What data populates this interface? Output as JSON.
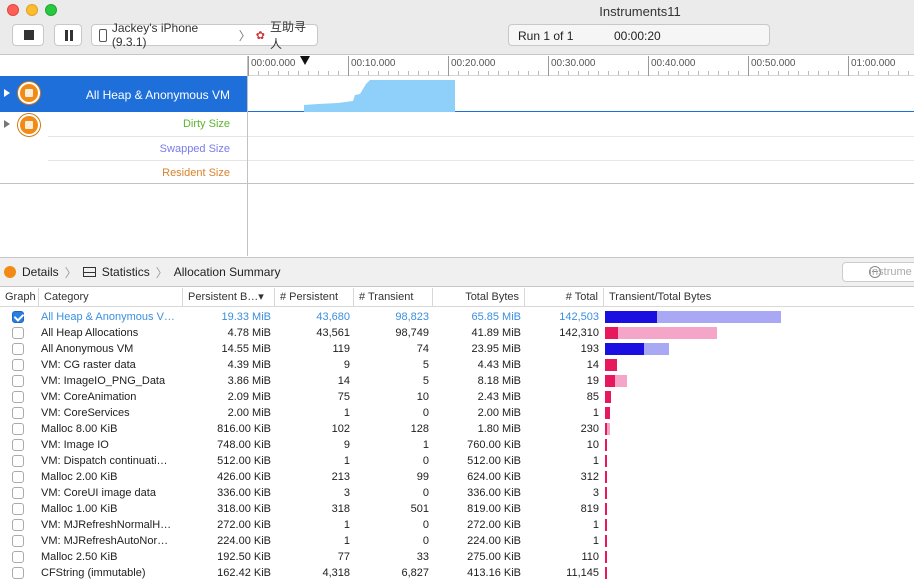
{
  "window": {
    "title": "Instruments11"
  },
  "toolbar": {
    "target_device": "Jackey's iPhone (9.3.1)",
    "target_app": "互助寻人",
    "run_label": "Run 1 of 1",
    "run_time": "00:00:20"
  },
  "timeline": {
    "ticks": [
      "00:00.000",
      "00:10.000",
      "00:20.000",
      "00:30.000",
      "00:40.000",
      "00:50.000",
      "01:00.000"
    ],
    "tracks": {
      "main": "All Heap & Anonymous VM",
      "sub": [
        "Dirty Size",
        "Swapped Size",
        "Resident Size"
      ]
    }
  },
  "colors": {
    "selection": "#1e6fd9",
    "graph_fill": "#8fd0fa",
    "persistent_blue": "#1a0fe0",
    "persistent_pink": "#e8185c",
    "transient_blue": "#a9a8f5",
    "transient_pink": "#f5a6c8",
    "dirty": "#5ab52c",
    "swapped": "#7b7be8",
    "resident": "#d9822b"
  },
  "jumpbar": {
    "crumbs": [
      "Details",
      "Statistics",
      "Allocation Summary"
    ],
    "filter_placeholder": "Instrume"
  },
  "table": {
    "columns": [
      "Graph",
      "Category",
      "Persistent B…▾",
      "# Persistent",
      "# Transient",
      "Total Bytes",
      "# Total",
      "Transient/Total Bytes"
    ],
    "rows": [
      {
        "checked": true,
        "category": "All Heap & Anonymous V…",
        "persistent_bytes": "19.33 MiB",
        "persistent": "43,680",
        "transient": "98,823",
        "total_bytes": "65.85 MiB",
        "total": "142,503",
        "bar_persistent": 19.33,
        "bar_total": 65.85,
        "bar_color": "blue"
      },
      {
        "checked": false,
        "category": "All Heap Allocations",
        "persistent_bytes": "4.78 MiB",
        "persistent": "43,561",
        "transient": "98,749",
        "total_bytes": "41.89 MiB",
        "total": "142,310",
        "bar_persistent": 4.78,
        "bar_total": 41.89,
        "bar_color": "pink"
      },
      {
        "checked": false,
        "category": "All Anonymous VM",
        "persistent_bytes": "14.55 MiB",
        "persistent": "119",
        "transient": "74",
        "total_bytes": "23.95 MiB",
        "total": "193",
        "bar_persistent": 14.55,
        "bar_total": 23.95,
        "bar_color": "blue"
      },
      {
        "checked": false,
        "category": "VM: CG raster data",
        "persistent_bytes": "4.39 MiB",
        "persistent": "9",
        "transient": "5",
        "total_bytes": "4.43 MiB",
        "total": "14",
        "bar_persistent": 4.39,
        "bar_total": 4.43,
        "bar_color": "pink"
      },
      {
        "checked": false,
        "category": "VM: ImageIO_PNG_Data",
        "persistent_bytes": "3.86 MiB",
        "persistent": "14",
        "transient": "5",
        "total_bytes": "8.18 MiB",
        "total": "19",
        "bar_persistent": 3.86,
        "bar_total": 8.18,
        "bar_color": "pink"
      },
      {
        "checked": false,
        "category": "VM: CoreAnimation",
        "persistent_bytes": "2.09 MiB",
        "persistent": "75",
        "transient": "10",
        "total_bytes": "2.43 MiB",
        "total": "85",
        "bar_persistent": 2.09,
        "bar_total": 2.43,
        "bar_color": "pink"
      },
      {
        "checked": false,
        "category": "VM: CoreServices",
        "persistent_bytes": "2.00 MiB",
        "persistent": "1",
        "transient": "0",
        "total_bytes": "2.00 MiB",
        "total": "1",
        "bar_persistent": 2.0,
        "bar_total": 2.0,
        "bar_color": "pink"
      },
      {
        "checked": false,
        "category": "Malloc 8.00 KiB",
        "persistent_bytes": "816.00 KiB",
        "persistent": "102",
        "transient": "128",
        "total_bytes": "1.80 MiB",
        "total": "230",
        "bar_persistent": 0.797,
        "bar_total": 1.8,
        "bar_color": "pink"
      },
      {
        "checked": false,
        "category": "VM: Image IO",
        "persistent_bytes": "748.00 KiB",
        "persistent": "9",
        "transient": "1",
        "total_bytes": "760.00 KiB",
        "total": "10",
        "bar_persistent": 0.73,
        "bar_total": 0.742,
        "bar_color": "pink"
      },
      {
        "checked": false,
        "category": "VM: Dispatch continuati…",
        "persistent_bytes": "512.00 KiB",
        "persistent": "1",
        "transient": "0",
        "total_bytes": "512.00 KiB",
        "total": "1",
        "bar_persistent": 0.5,
        "bar_total": 0.5,
        "bar_color": "pink"
      },
      {
        "checked": false,
        "category": "Malloc 2.00 KiB",
        "persistent_bytes": "426.00 KiB",
        "persistent": "213",
        "transient": "99",
        "total_bytes": "624.00 KiB",
        "total": "312",
        "bar_persistent": 0.416,
        "bar_total": 0.609,
        "bar_color": "pink"
      },
      {
        "checked": false,
        "category": "VM: CoreUI image data",
        "persistent_bytes": "336.00 KiB",
        "persistent": "3",
        "transient": "0",
        "total_bytes": "336.00 KiB",
        "total": "3",
        "bar_persistent": 0.328,
        "bar_total": 0.328,
        "bar_color": "pink"
      },
      {
        "checked": false,
        "category": "Malloc 1.00 KiB",
        "persistent_bytes": "318.00 KiB",
        "persistent": "318",
        "transient": "501",
        "total_bytes": "819.00 KiB",
        "total": "819",
        "bar_persistent": 0.311,
        "bar_total": 0.8,
        "bar_color": "pink"
      },
      {
        "checked": false,
        "category": "VM: MJRefreshNormalH…",
        "persistent_bytes": "272.00 KiB",
        "persistent": "1",
        "transient": "0",
        "total_bytes": "272.00 KiB",
        "total": "1",
        "bar_persistent": 0.266,
        "bar_total": 0.266,
        "bar_color": "pink"
      },
      {
        "checked": false,
        "category": "VM: MJRefreshAutoNor…",
        "persistent_bytes": "224.00 KiB",
        "persistent": "1",
        "transient": "0",
        "total_bytes": "224.00 KiB",
        "total": "1",
        "bar_persistent": 0.219,
        "bar_total": 0.219,
        "bar_color": "pink"
      },
      {
        "checked": false,
        "category": "Malloc 2.50 KiB",
        "persistent_bytes": "192.50 KiB",
        "persistent": "77",
        "transient": "33",
        "total_bytes": "275.00 KiB",
        "total": "110",
        "bar_persistent": 0.188,
        "bar_total": 0.269,
        "bar_color": "pink"
      },
      {
        "checked": false,
        "category": "CFString (immutable)",
        "persistent_bytes": "162.42 KiB",
        "persistent": "4,318",
        "transient": "6,827",
        "total_bytes": "413.16 KiB",
        "total": "11,145",
        "bar_persistent": 0.159,
        "bar_total": 0.403,
        "bar_color": "pink"
      }
    ]
  }
}
